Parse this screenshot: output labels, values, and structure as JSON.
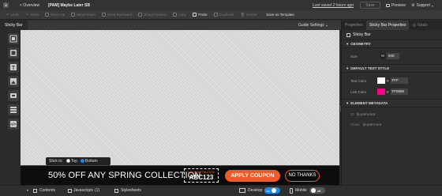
{
  "topbar": {
    "overview_label": "< Overview",
    "campaign_title": "[PAM] Maybe Later SB",
    "last_saved": "Last saved 2 hours ago",
    "save_label": "Save",
    "preview_label": "Preview",
    "support_label": "Support"
  },
  "toolbar": {
    "undo": "Undo",
    "redo": "Redo",
    "move_up": "Move Up",
    "move_down": "Move Down",
    "send_backward": "Send Backward",
    "bring_forward": "Bring Forward",
    "copy": "Copy",
    "paste": "Paste",
    "duplicate": "Duplicate",
    "delete": "Delete",
    "save_as_template": "Save as Template"
  },
  "canvas_tab": {
    "label": "Sticky Bar",
    "guide_settings": "Guide Settings"
  },
  "stick_to": {
    "label": "Stick to:",
    "options": [
      "Top",
      "Bottom"
    ],
    "selected": "Bottom"
  },
  "promo": {
    "headline": "50% OFF ANY SPRING COLLECTION",
    "coupon_caption": "USE COUPON CODE",
    "coupon_code": "ABC123",
    "apply_label": "APPLY COUPON",
    "no_thanks_label": "NO THANKS",
    "colors": {
      "bg": "#0d0d0d",
      "apply": "#f05a28",
      "no_thanks_border": "#f05a28",
      "text": "#ffffff"
    }
  },
  "bottombar": {
    "contents_label": "Contents",
    "javascripts_label": "Javascripts",
    "javascripts_count": "(1)",
    "stylesheets_label": "Stylesheets",
    "desktop_label": "Desktop",
    "desktop_toggle": "on",
    "mobile_label": "Mobile",
    "mobile_toggle": "off"
  },
  "rightpanel": {
    "tabs": [
      "Properties",
      "Sticky Bar Properties",
      "Goals"
    ],
    "active_tab": "Sticky Bar Properties",
    "element_label": "Sticky Bar",
    "geometry_header": "GEOMETRY",
    "size_label": "Size",
    "size_unit": "W",
    "size_value": "940",
    "text_style_header": "DEFAULT TEXT STYLE",
    "text_color_label": "Text Color",
    "text_color_value": "FFF",
    "text_color_hex": "#ffffff",
    "link_color_label": "Link Color",
    "link_color_value": "FF0086",
    "link_color_hex": "#ff0086",
    "hash_symbol": "#",
    "metadata_header": "ELEMENT METADATA",
    "id_label": "ID:",
    "id_value": "lp-pom-root",
    "class_label": "Class:",
    "class_value": "lp-pom-root"
  }
}
